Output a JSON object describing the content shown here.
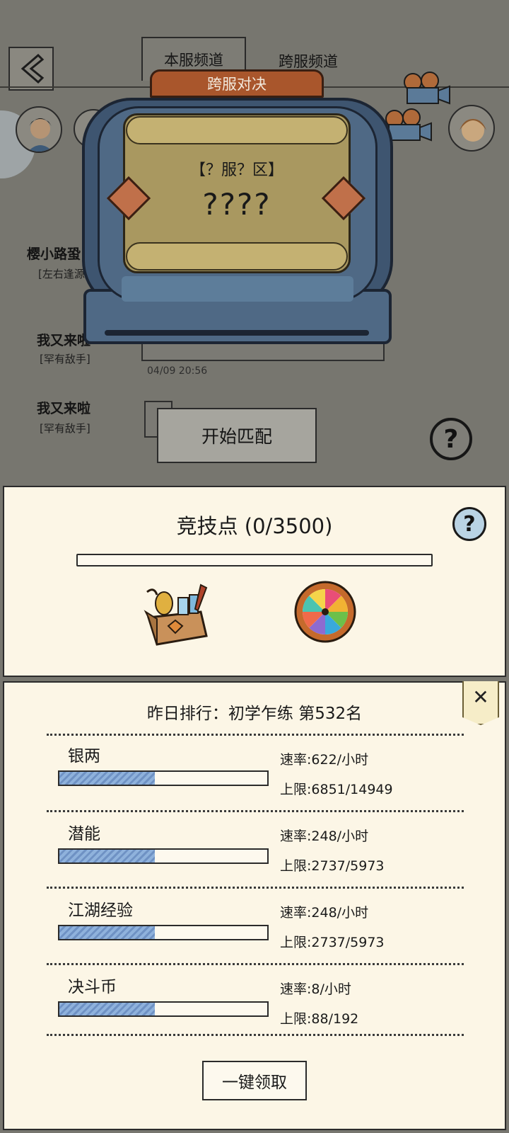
{
  "background": {
    "tabs": {
      "local": "本服频道",
      "cross": "跨服频道"
    },
    "messages": [
      {
        "name": "樱小路蛩",
        "title": "[左右逢源"
      },
      {
        "name": "我又来啦",
        "title": "[罕有敌手]",
        "time": "04/09 20:56"
      },
      {
        "name": "我又来啦",
        "title": "[罕有敌手]"
      }
    ]
  },
  "match": {
    "tab_label": "跨服对决",
    "server_label": "【？服？区】",
    "opponent": "????",
    "start_button": "开始匹配"
  },
  "arena": {
    "title": "竞技点 (0/3500)",
    "points": 0,
    "points_max": 3500,
    "rewards": [
      "gift-box-icon",
      "prize-wheel-icon"
    ]
  },
  "rewards_panel": {
    "rank_text": "昨日排行：初学乍练 第532名",
    "resources": [
      {
        "name": "银两",
        "rate": "速率:622/小时",
        "cap": "上限:6851/14949",
        "progress": 0.458
      },
      {
        "name": "潜能",
        "rate": "速率:248/小时",
        "cap": "上限:2737/5973",
        "progress": 0.458
      },
      {
        "name": "江湖经验",
        "rate": "速率:248/小时",
        "cap": "上限:2737/5973",
        "progress": 0.458
      },
      {
        "name": "决斗币",
        "rate": "速率:8/小时",
        "cap": "上限:88/192",
        "progress": 0.458
      }
    ],
    "claim_button": "一键领取"
  },
  "colors": {
    "overlay": "#77766f",
    "panel": "#fcf6e6",
    "machine": "#3e5570",
    "machine_tab": "#a9562c",
    "bar_fill": "#8fb2dc",
    "help_button": "#b9d3e4"
  }
}
